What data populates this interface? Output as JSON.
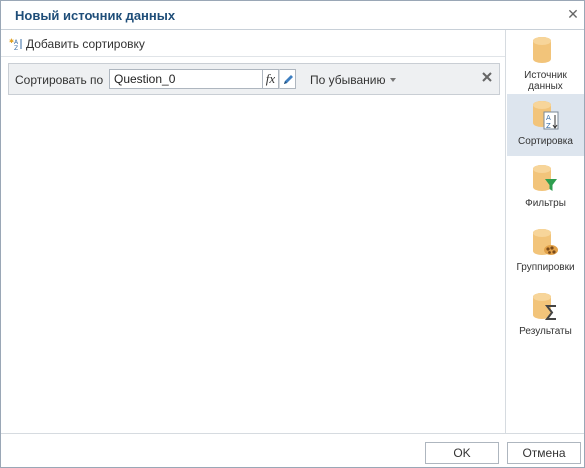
{
  "dialog": {
    "title": "Новый источник данных"
  },
  "toolbar": {
    "add_sort_label": "Добавить сортировку"
  },
  "sort_row": {
    "label": "Сортировать по",
    "field_value": "Question_0",
    "fx_label": "fx",
    "order_label": "По убыванию"
  },
  "sidebar": {
    "items": [
      {
        "label": "Источник данных",
        "icon": "database-icon",
        "active": false
      },
      {
        "label": "Сортировка",
        "icon": "database-sort-icon",
        "active": true
      },
      {
        "label": "Фильтры",
        "icon": "database-filter-icon",
        "active": false
      },
      {
        "label": "Группировки",
        "icon": "database-group-icon",
        "active": false
      },
      {
        "label": "Результаты",
        "icon": "database-sum-icon",
        "active": false
      }
    ]
  },
  "footer": {
    "ok_label": "OK",
    "cancel_label": "Отмена"
  },
  "colors": {
    "title": "#1f4e79",
    "active_sidebar": "#dde5ee",
    "db_icon": "#f2c47a",
    "filter_icon": "#2e9e4f"
  }
}
